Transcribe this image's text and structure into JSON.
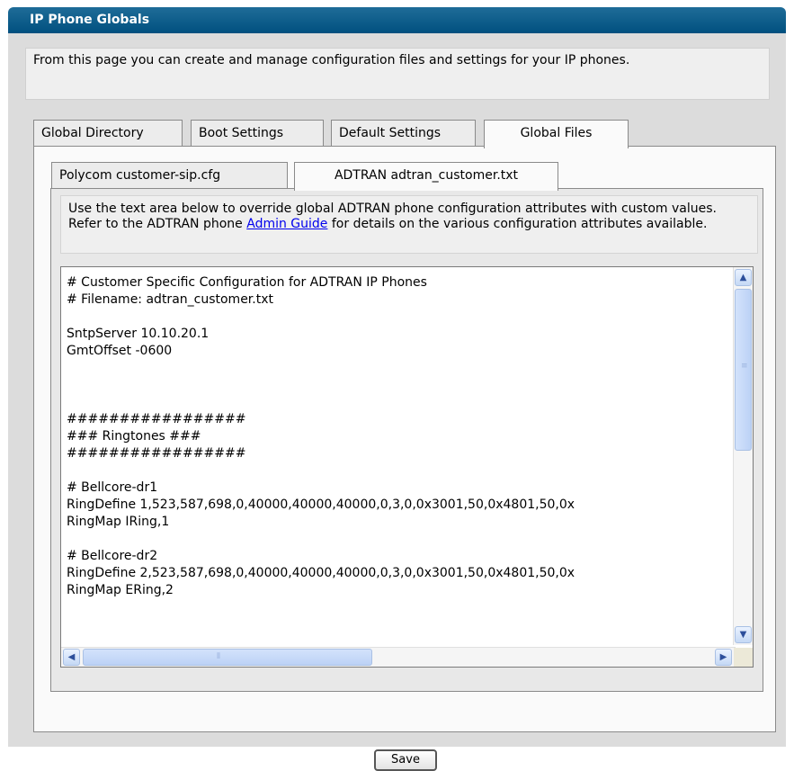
{
  "header": {
    "title": "IP Phone Globals"
  },
  "description": "From this page you can create and manage configuration files and settings for your IP phones.",
  "main_tabs": [
    {
      "label": "Global Directory"
    },
    {
      "label": "Boot Settings"
    },
    {
      "label": "Default Settings"
    },
    {
      "label": "Global Files"
    }
  ],
  "active_main_tab": "Global Files",
  "sub_tabs": [
    {
      "label": "Polycom customer-sip.cfg"
    },
    {
      "label": "ADTRAN adtran_customer.txt"
    }
  ],
  "active_sub_tab": "ADTRAN adtran_customer.txt",
  "note": {
    "text_before": "Use the text area below to override global ADTRAN phone configuration attributes with custom values. Refer to the ADTRAN phone ",
    "link": "Admin Guide",
    "text_after": " for details on the various configuration attributes available."
  },
  "editor": {
    "lines": [
      "# Customer Specific Configuration for ADTRAN IP Phones",
      "# Filename: adtran_customer.txt",
      "",
      "SntpServer 10.10.20.1",
      "GmtOffset -0600",
      "",
      "",
      "",
      "#################",
      "### Ringtones ###",
      "#################",
      "",
      "# Bellcore-dr1",
      "RingDefine 1,523,587,698,0,40000,40000,40000,0,3,0,0x3001,50,0x4801,50,0x",
      "RingMap IRing,1",
      "",
      "# Bellcore-dr2",
      "RingDefine 2,523,587,698,0,40000,40000,40000,0,3,0,0x3001,50,0x4801,50,0x",
      "RingMap ERing,2"
    ],
    "icons": {
      "scroll_up": "scroll-up-arrow-icon",
      "scroll_down": "scroll-down-arrow-icon",
      "scroll_left": "scroll-left-arrow-icon",
      "scroll_right": "scroll-right-arrow-icon"
    }
  },
  "actions": {
    "save_label": "Save"
  },
  "colors": {
    "header": "#00507f",
    "link": "#0000ee",
    "panel": "#dcdcdc"
  }
}
